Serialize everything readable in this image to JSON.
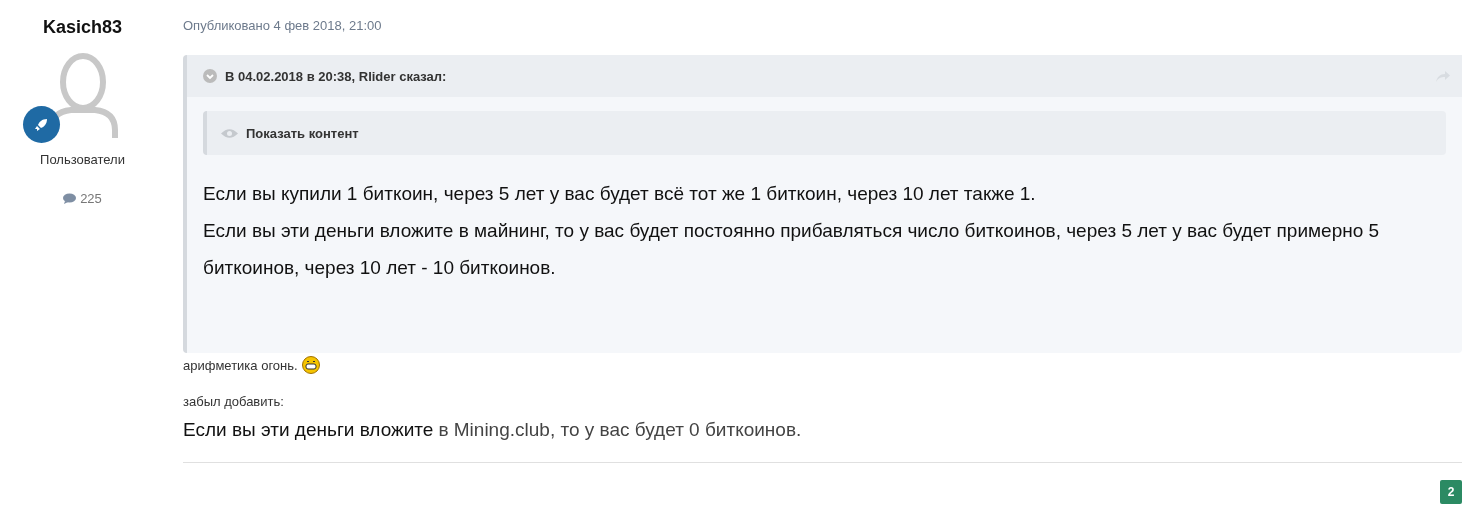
{
  "author": {
    "name": "Kasich83",
    "group": "Пользователи",
    "post_count": "225"
  },
  "post": {
    "date": "Опубликовано 4 фев 2018, 21:00",
    "quote": {
      "citation": "В 04.02.2018 в 20:38, Rlider сказал:",
      "spoiler": "Показать контент",
      "paragraphs": [
        "Если вы купили 1 биткоин, через 5 лет у вас будет всё тот же 1 биткоин, через 10 лет также 1.",
        "Если вы эти деньги вложите в майнинг, то у вас будет постоянно прибавляться число биткоинов, через 5 лет у вас будет примерно 5 биткоинов, через 10 лет - 10 биткоинов."
      ]
    },
    "remark": "арифметика огонь.",
    "note": "забыл добавить:",
    "final_line": {
      "lead": "Если вы эти деньги вложите",
      "rest": "в Mining.club, то у вас будет 0 биткоинов."
    },
    "reputation": "2"
  }
}
